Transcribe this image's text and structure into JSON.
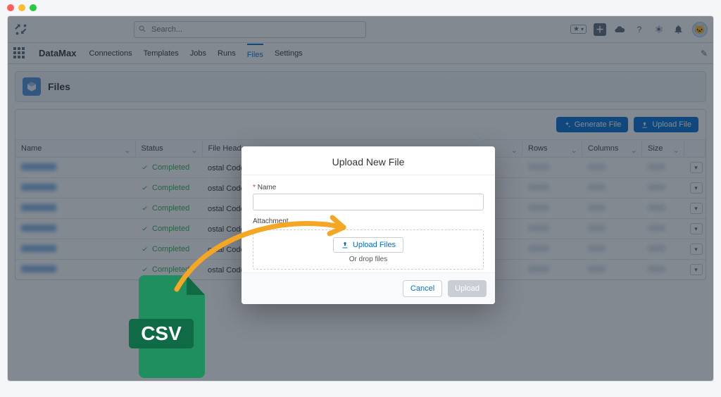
{
  "search": {
    "placeholder": "Search..."
  },
  "brand": "DataMax",
  "nav": {
    "items": [
      "Connections",
      "Templates",
      "Jobs",
      "Runs",
      "Files",
      "Settings"
    ],
    "active": 4
  },
  "page": {
    "title": "Files"
  },
  "actions": {
    "generate": "Generate File",
    "upload": "Upload File"
  },
  "columns": [
    "Name",
    "Status",
    "File Headers",
    "Rows",
    "Columns",
    "Size"
  ],
  "status_label": "Completed",
  "file_headers_snippet": "ostal Code,...",
  "row_count": 6,
  "modal": {
    "title": "Upload New File",
    "name_label": "Name",
    "attach_label": "Attachment",
    "upload_btn": "Upload Files",
    "drop_text": "Or drop files",
    "cancel": "Cancel",
    "submit": "Upload"
  }
}
